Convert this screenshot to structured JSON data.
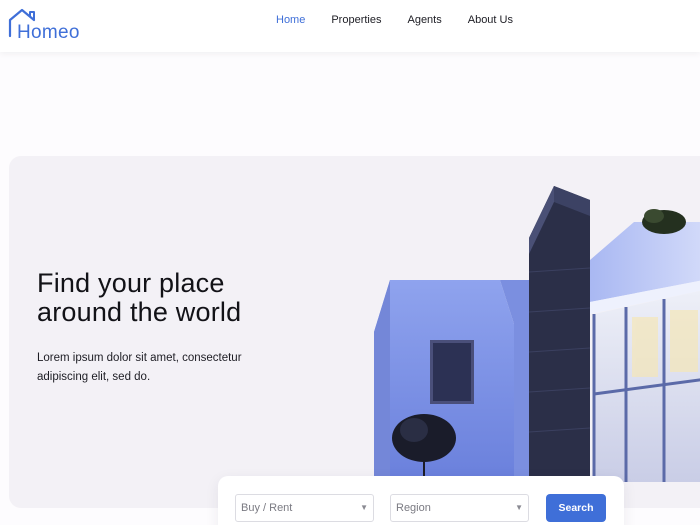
{
  "brand": {
    "name": "Homeo",
    "accent_color": "#3f6fd8"
  },
  "nav": {
    "items": [
      {
        "label": "Home",
        "active": true
      },
      {
        "label": "Properties",
        "active": false
      },
      {
        "label": "Agents",
        "active": false
      },
      {
        "label": "About Us",
        "active": false
      }
    ]
  },
  "hero": {
    "title_line1": "Find your place",
    "title_line2": "around the world",
    "description": "Lorem ipsum dolor sit amet, consectetur adipiscing elit, sed do.",
    "image_icon": "modern-house-photo"
  },
  "search": {
    "type_select": {
      "value": "Buy / Rent"
    },
    "region_select": {
      "value": "Region"
    },
    "button_label": "Search"
  }
}
